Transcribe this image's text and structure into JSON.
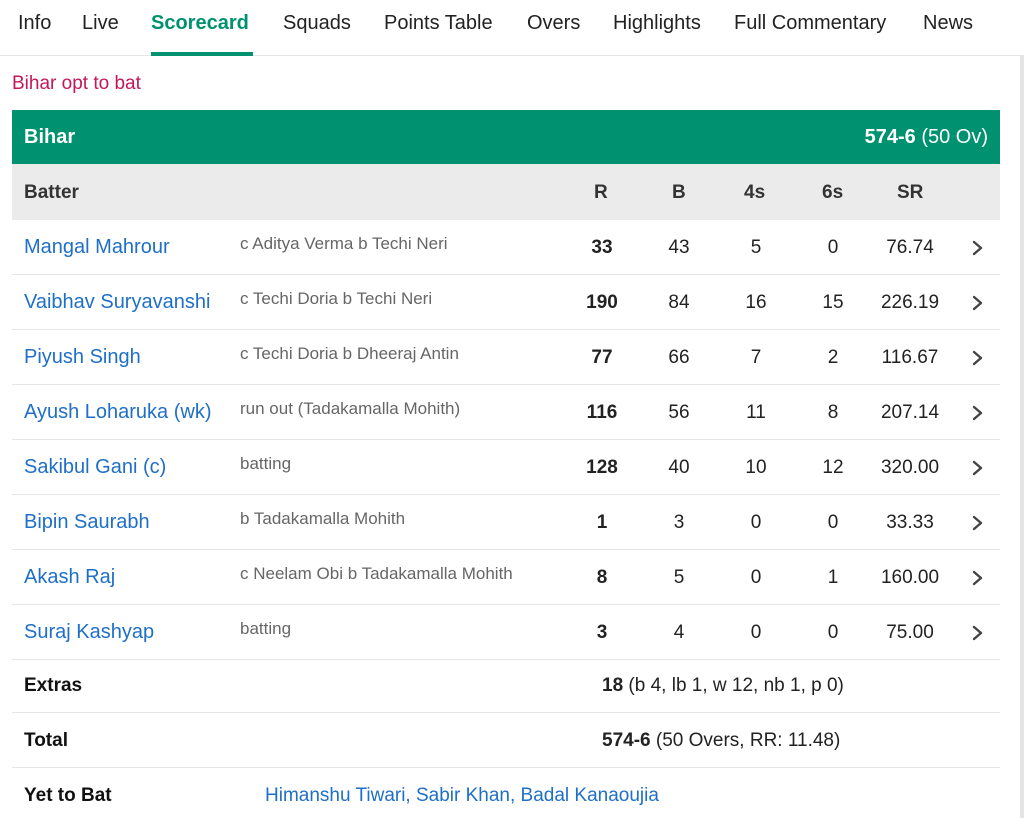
{
  "tabs": [
    "Info",
    "Live",
    "Scorecard",
    "Squads",
    "Points Table",
    "Overs",
    "Highlights",
    "Full Commentary",
    "News"
  ],
  "active_tab": "Scorecard",
  "toss": "Bihar opt to bat",
  "innings": {
    "team": "Bihar",
    "score": "574-6",
    "overs": "(50 Ov)"
  },
  "columns": {
    "batter": "Batter",
    "r": "R",
    "b": "B",
    "fours": "4s",
    "sixes": "6s",
    "sr": "SR"
  },
  "batters": [
    {
      "name": "Mangal Mahrour",
      "dismissal": "c Aditya Verma b Techi Neri",
      "r": "33",
      "b": "43",
      "fours": "5",
      "sixes": "0",
      "sr": "76.74"
    },
    {
      "name": "Vaibhav Suryavanshi",
      "dismissal": "c Techi Doria b Techi Neri",
      "r": "190",
      "b": "84",
      "fours": "16",
      "sixes": "15",
      "sr": "226.19"
    },
    {
      "name": "Piyush Singh",
      "dismissal": "c Techi Doria b Dheeraj Antin",
      "r": "77",
      "b": "66",
      "fours": "7",
      "sixes": "2",
      "sr": "116.67"
    },
    {
      "name": "Ayush Loharuka (wk)",
      "dismissal": "run out (Tadakamalla Mohith)",
      "r": "116",
      "b": "56",
      "fours": "11",
      "sixes": "8",
      "sr": "207.14"
    },
    {
      "name": "Sakibul Gani (c)",
      "dismissal": "batting",
      "r": "128",
      "b": "40",
      "fours": "10",
      "sixes": "12",
      "sr": "320.00"
    },
    {
      "name": "Bipin Saurabh",
      "dismissal": "b Tadakamalla Mohith",
      "r": "1",
      "b": "3",
      "fours": "0",
      "sixes": "0",
      "sr": "33.33"
    },
    {
      "name": "Akash Raj",
      "dismissal": "c Neelam Obi b Tadakamalla Mohith",
      "r": "8",
      "b": "5",
      "fours": "0",
      "sixes": "1",
      "sr": "160.00"
    },
    {
      "name": "Suraj Kashyap",
      "dismissal": "batting",
      "r": "3",
      "b": "4",
      "fours": "0",
      "sixes": "0",
      "sr": "75.00"
    }
  ],
  "extras": {
    "label": "Extras",
    "total": "18",
    "detail": "(b 4, lb 1, w 12, nb 1, p 0)"
  },
  "total": {
    "label": "Total",
    "score": "574-6",
    "detail": "(50 Overs, RR: 11.48)"
  },
  "yet_to_bat": {
    "label": "Yet to Bat",
    "players": "Himanshu Tiwari, Sabir Khan, Badal Kanaoujia"
  },
  "colors": {
    "accent": "#009270",
    "link": "#1e6fc7",
    "toss": "#c2185b",
    "header_bg": "#ebebeb"
  }
}
